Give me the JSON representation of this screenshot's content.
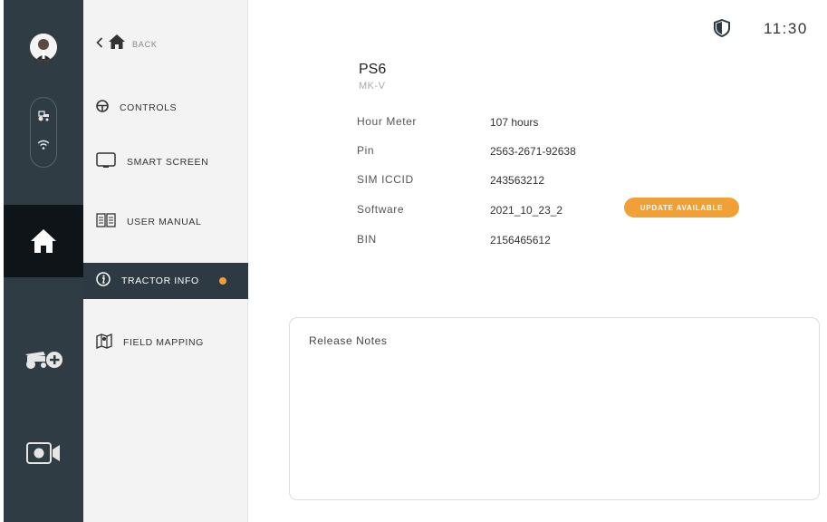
{
  "rail": {
    "icons": [
      "user-avatar",
      "tractor-icon",
      "wifi-icon",
      "home-icon",
      "tractor-add-icon",
      "camera-icon"
    ]
  },
  "subnav": {
    "back_label": "BACK",
    "items": [
      {
        "label": "CONTROLS",
        "icon": "steering-wheel-icon"
      },
      {
        "label": "SMART SCREEN",
        "icon": "monitor-icon"
      },
      {
        "label": "USER MANUAL",
        "icon": "book-icon"
      },
      {
        "label": "TRACTOR INFO",
        "icon": "info-icon",
        "active": true
      },
      {
        "label": "FIELD MAPPING",
        "icon": "map-icon"
      }
    ]
  },
  "header": {
    "time": "11:30",
    "shield_icon": "shield-icon"
  },
  "tractor": {
    "model": "PS6",
    "variant": "MK-V",
    "rows": [
      {
        "key": "Hour Meter",
        "value": "107 hours"
      },
      {
        "key": "Pin",
        "value": "2563-2671-92638"
      },
      {
        "key": "SIM ICCID",
        "value": "243563212"
      },
      {
        "key": "Software",
        "value": "2021_10_23_2"
      },
      {
        "key": "BIN",
        "value": "2156465612"
      }
    ],
    "update_badge": "UPDATE AVAILABLE"
  },
  "release_notes": {
    "title": "Release Notes"
  },
  "colors": {
    "rail": "#303c44",
    "active": "#2d3a43",
    "accent": "#f1a037",
    "home_tile": "#0f1418"
  }
}
